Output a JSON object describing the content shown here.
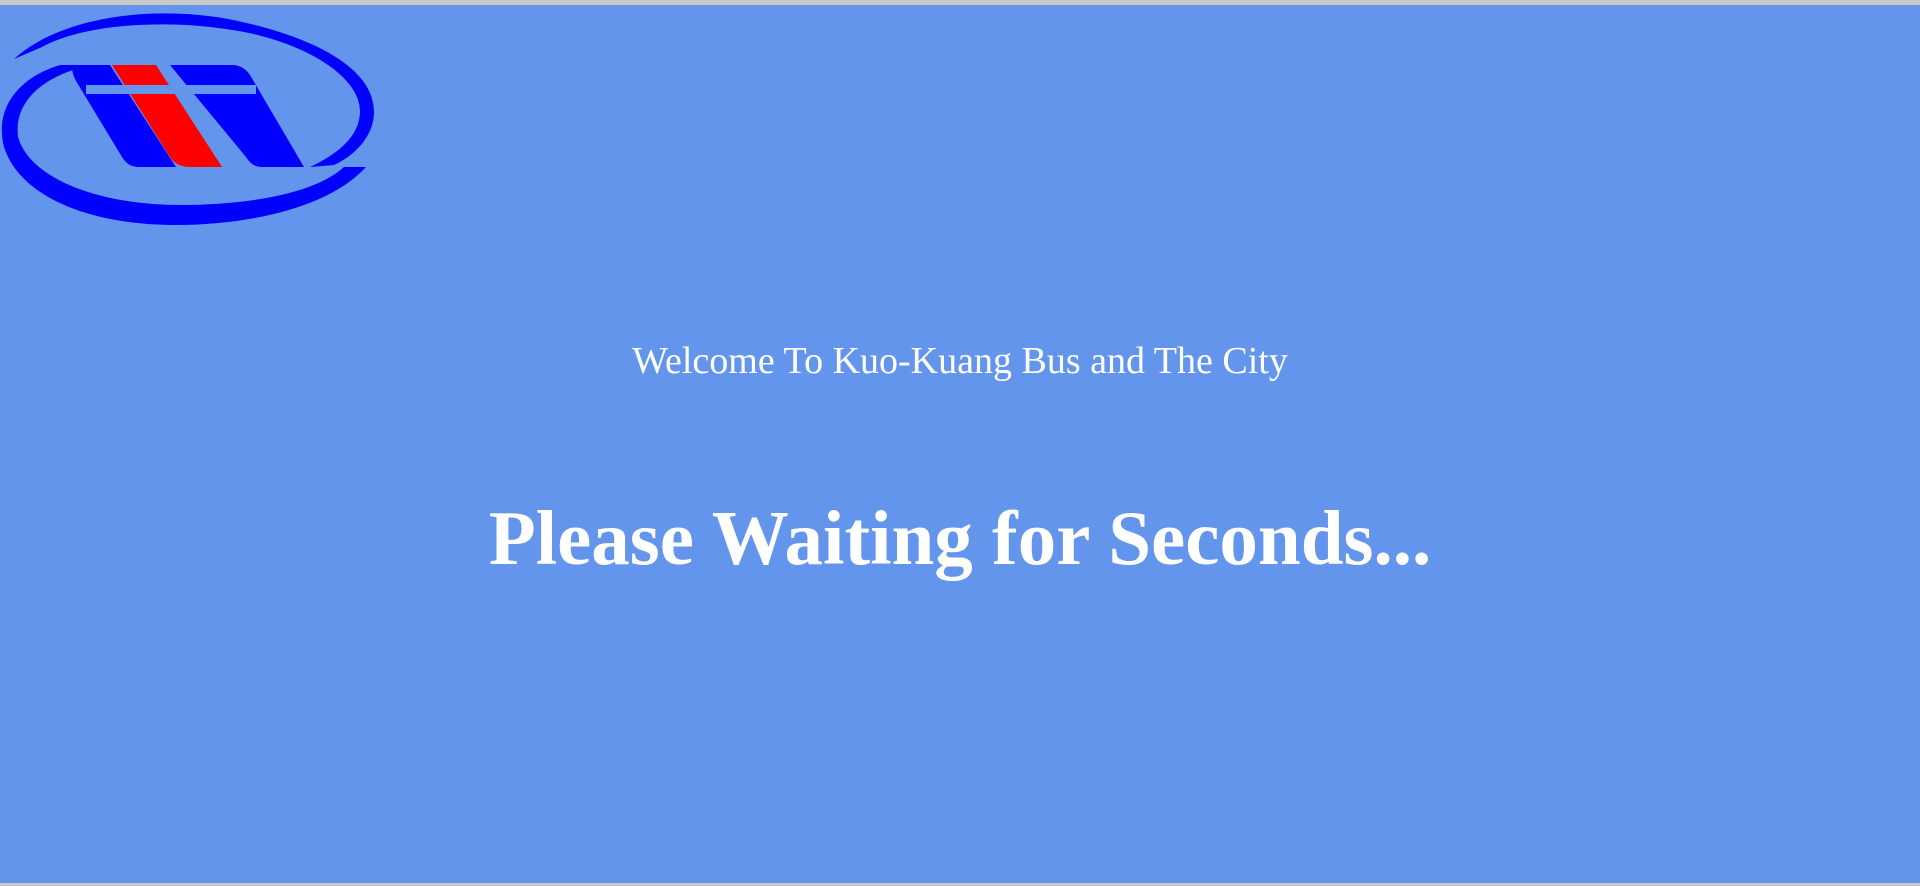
{
  "colors": {
    "background": "#6495ED",
    "text": "#FFFFFF",
    "logo_primary": "#0000FF",
    "logo_accent": "#FF0000",
    "frame_border": "#C8C8C8"
  },
  "logo": {
    "icon": "kuo-kuang-bus-logo"
  },
  "welcome_text": "Welcome To Kuo-Kuang Bus and The City",
  "waiting_text": "Please Waiting for Seconds..."
}
